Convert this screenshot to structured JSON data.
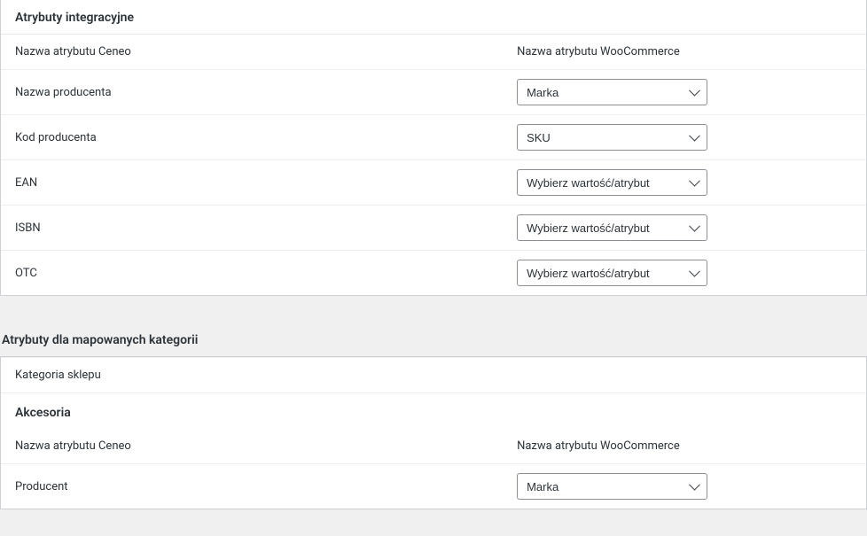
{
  "integration": {
    "title": "Atrybuty integracyjne",
    "col_ceneo": "Nazwa atrybutu Ceneo",
    "col_woo": "Nazwa atrybutu WooCommerce",
    "rows": {
      "producer_name": {
        "label": "Nazwa producenta",
        "value": "Marka"
      },
      "producer_code": {
        "label": "Kod producenta",
        "value": "SKU"
      },
      "ean": {
        "label": "EAN",
        "value": "Wybierz wartość/atrybut"
      },
      "isbn": {
        "label": "ISBN",
        "value": "Wybierz wartość/atrybut"
      },
      "otc": {
        "label": "OTC",
        "value": "Wybierz wartość/atrybut"
      }
    }
  },
  "mapped": {
    "title": "Atrybuty dla mapowanych kategorii",
    "store_category": "Kategoria sklepu",
    "accessories": {
      "title": "Akcesoria",
      "col_ceneo": "Nazwa atrybutu Ceneo",
      "col_woo": "Nazwa atrybutu WooCommerce",
      "rows": {
        "producent": {
          "label": "Producent",
          "value": "Marka"
        }
      }
    }
  },
  "options": {
    "placeholder": "Wybierz wartość/atrybut",
    "marka": "Marka",
    "sku": "SKU"
  }
}
